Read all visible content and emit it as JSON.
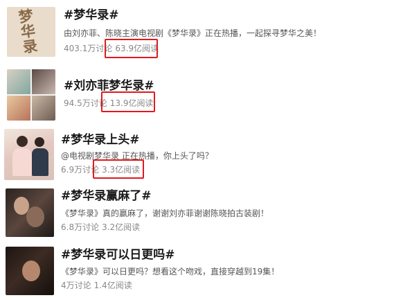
{
  "topics": [
    {
      "title": "#梦华录#",
      "description": "由刘亦菲、陈晓主演电视剧《梦华录》正在热播，一起探寻梦华之美！",
      "discussions": "403.1万讨论",
      "reads": "63.9亿阅读",
      "thumb_text": "梦华录",
      "highlighted": true
    },
    {
      "title": "#刘亦菲梦华录#",
      "description": "",
      "discussions": "94.5万讨论",
      "reads": "13.9亿阅读",
      "highlighted": true
    },
    {
      "title": "#梦华录上头#",
      "description": "@电视剧梦华录 正在热播，你上头了吗？",
      "discussions": "6.9万讨论",
      "reads": "3.3亿阅读",
      "highlighted": true
    },
    {
      "title": "#梦华录赢麻了#",
      "description": "《梦华录》真的赢麻了，谢谢刘亦菲谢谢陈晓拍古装剧！",
      "discussions": "6.8万讨论",
      "reads": "3.2亿阅读",
      "highlighted": false
    },
    {
      "title": "#梦华录可以日更吗#",
      "description": "《梦华录》可以日更吗？想看这个吻戏，直接穿越到19集！",
      "discussions": "4万讨论",
      "reads": "1.4亿阅读",
      "highlighted": false
    }
  ],
  "colors": {
    "highlight_border": "#e0191d",
    "title": "#1a1a1a",
    "description": "#555555",
    "stats": "#888888"
  }
}
